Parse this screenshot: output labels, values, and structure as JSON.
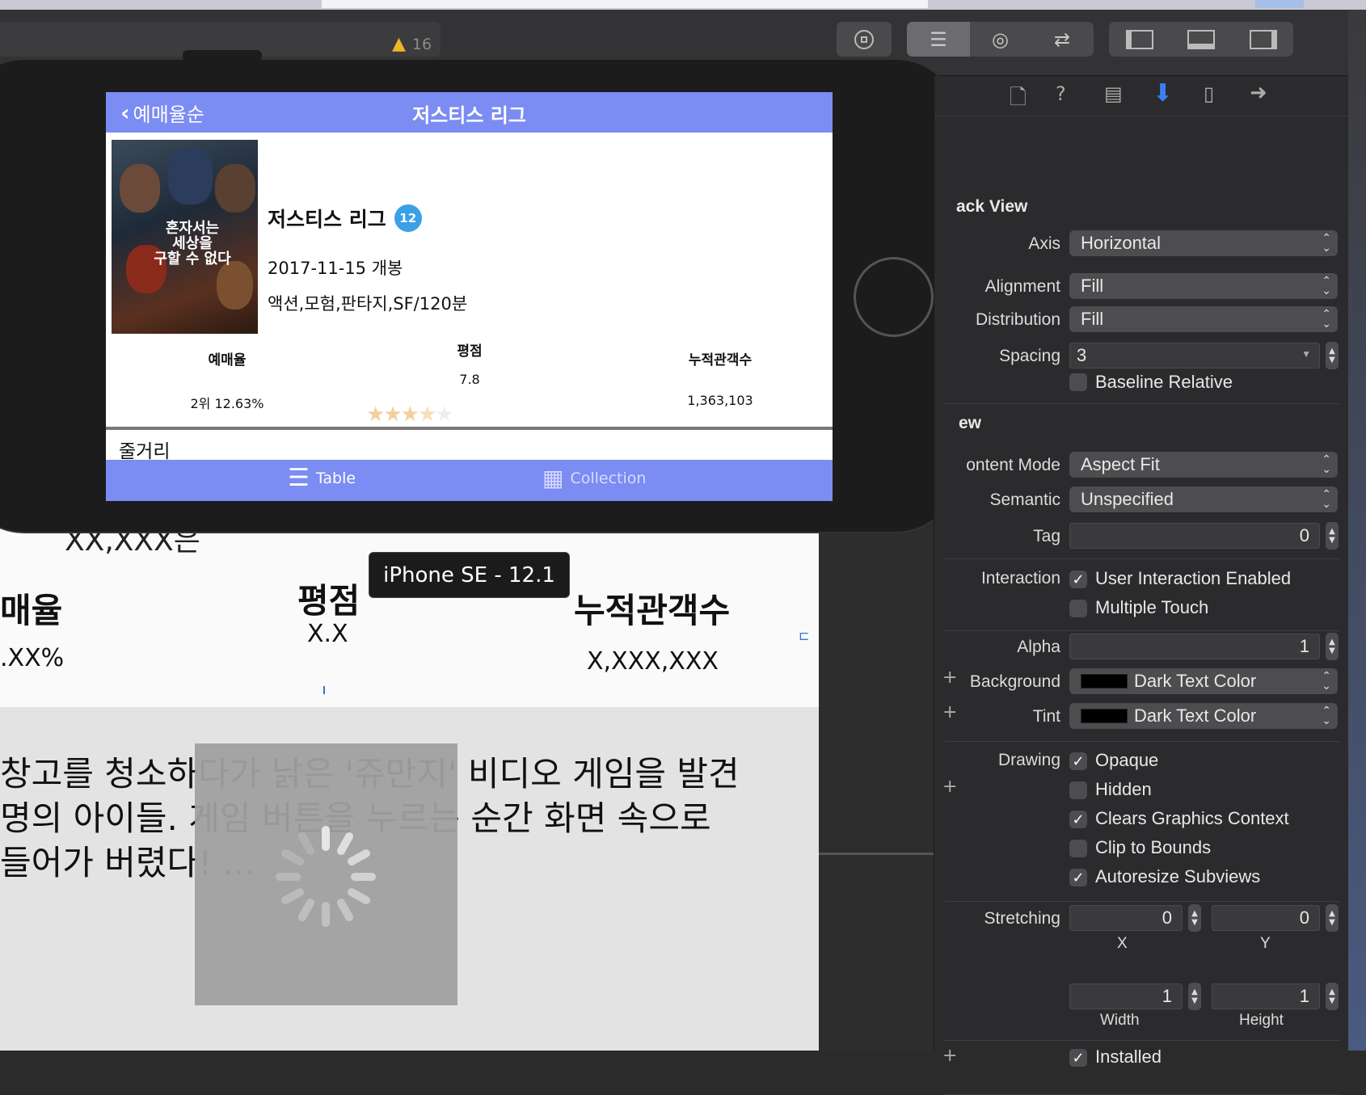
{
  "toolbar": {
    "warning_count": "16"
  },
  "device": {
    "nav_back": "예매율순",
    "nav_title": "저스티스 리그",
    "movie_title": "저스티스 리그",
    "age_badge": "12",
    "release": "2017-11-15 개봉",
    "genre": "액션,모험,판타지,SF/120분",
    "stats": [
      {
        "label": "예매율",
        "value": "2위 12.63%"
      },
      {
        "label": "평점",
        "value": "7.8"
      },
      {
        "label": "누적관객수",
        "value": "1,363,103"
      }
    ],
    "rating_stars": 3.5,
    "synopsis_label": "줄거리",
    "tabs": [
      {
        "label": "Table"
      },
      {
        "label": "Collection"
      }
    ],
    "poster_text": "혼자서는\n세상을\n구할 수 없다"
  },
  "storyboard": {
    "partial_top": "XX,XXX은",
    "h_rate": "매율",
    "h_score": "평점",
    "h_audience": "누적관객수",
    "v_rate": ".XX%",
    "v_score": "X.X",
    "v_audience": "X,XXX,XXX",
    "synopsis_1": "창고를 청소하다가 낡은 '쥬만지' 비디오 게임을 발견",
    "synopsis_2": "명의 아이들. 게임 버튼을 누르는 순간 화면 속으로",
    "synopsis_3": "들어가 버렸다! ..."
  },
  "device_label": "iPhone SE - 12.1",
  "inspector": {
    "section_stack": "ack View",
    "axis_label": "Axis",
    "axis_value": "Horizontal",
    "alignment_label": "Alignment",
    "alignment_value": "Fill",
    "distribution_label": "Distribution",
    "distribution_value": "Fill",
    "spacing_label": "Spacing",
    "spacing_value": "3",
    "baseline_label": "Baseline Relative",
    "baseline_checked": false,
    "section_view": "ew",
    "content_mode_label": "ontent Mode",
    "content_mode_value": "Aspect Fit",
    "semantic_label": "Semantic",
    "semantic_value": "Unspecified",
    "tag_label": "Tag",
    "tag_value": "0",
    "interaction_label": "Interaction",
    "user_interaction": "User Interaction Enabled",
    "user_interaction_checked": true,
    "multiple_touch": "Multiple Touch",
    "multiple_touch_checked": false,
    "alpha_label": "Alpha",
    "alpha_value": "1",
    "background_label": "Background",
    "background_value": "Dark Text Color",
    "tint_label": "Tint",
    "tint_value": "Dark Text Color",
    "drawing_label": "Drawing",
    "opaque": "Opaque",
    "opaque_checked": true,
    "hidden": "Hidden",
    "hidden_checked": false,
    "clears": "Clears Graphics Context",
    "clears_checked": true,
    "clip": "Clip to Bounds",
    "clip_checked": false,
    "autoresize": "Autoresize Subviews",
    "autoresize_checked": true,
    "stretching_label": "Stretching",
    "stretch_x": "0",
    "stretch_y": "0",
    "stretch_w": "1",
    "stretch_h": "1",
    "x_label": "X",
    "y_label": "Y",
    "width_label": "Width",
    "height_label": "Height",
    "installed": "Installed",
    "installed_checked": true
  }
}
